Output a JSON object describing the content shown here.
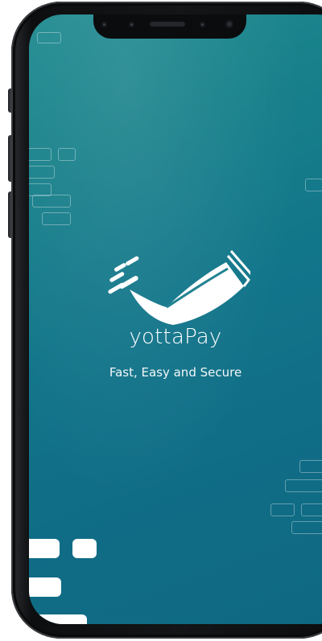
{
  "app": {
    "name": "yottaPay",
    "tagline": "Fast, Easy and Secure"
  },
  "logo": {
    "icon": "yottapay-logo-icon"
  },
  "colors": {
    "background_top": "#1f8a90",
    "background_bottom": "#0f6882",
    "text": "#ffffff",
    "frame": "#111214"
  }
}
